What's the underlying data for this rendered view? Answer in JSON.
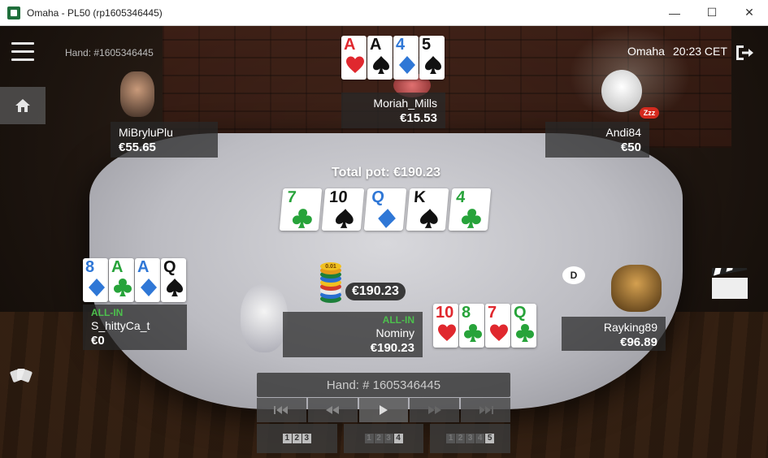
{
  "window": {
    "title": "Omaha - PL50 (rp1605346445)",
    "minimize": "—",
    "maximize": "☐",
    "close": "✕"
  },
  "hud": {
    "hand_label": "Hand: #1605346445",
    "game": "Omaha",
    "time": "20:23 CET"
  },
  "pot": {
    "total": "Total pot: €190.23",
    "center": "€190.23"
  },
  "board": [
    {
      "rank": "7",
      "suit": "club"
    },
    {
      "rank": "10",
      "suit": "spade"
    },
    {
      "rank": "Q",
      "suit": "diamond"
    },
    {
      "rank": "K",
      "suit": "spade"
    },
    {
      "rank": "4",
      "suit": "club"
    }
  ],
  "players": {
    "moriah": {
      "name": "Moriah_Mills",
      "stack": "€15.53",
      "cards": [
        {
          "rank": "A",
          "suit": "heart"
        },
        {
          "rank": "A",
          "suit": "spade"
        },
        {
          "rank": "4",
          "suit": "diamond"
        },
        {
          "rank": "5",
          "suit": "spade"
        }
      ]
    },
    "mibryluplu": {
      "name": "MiBryluPlu",
      "stack": "€55.65"
    },
    "andi": {
      "name": "Andi84",
      "stack": "€50",
      "sleep_badge": "Zzz"
    },
    "shitty": {
      "name": "S_hittyCa_t",
      "stack": "€0",
      "status": "ALL-IN",
      "cards": [
        {
          "rank": "8",
          "suit": "diamond"
        },
        {
          "rank": "A",
          "suit": "club"
        },
        {
          "rank": "A",
          "suit": "diamond"
        },
        {
          "rank": "Q",
          "suit": "spade"
        }
      ]
    },
    "nominy": {
      "name": "Nominy",
      "stack": "€190.23",
      "status": "ALL-IN",
      "cards": [
        {
          "rank": "10",
          "suit": "heart"
        },
        {
          "rank": "8",
          "suit": "club"
        },
        {
          "rank": "7",
          "suit": "heart"
        },
        {
          "rank": "Q",
          "suit": "club"
        }
      ]
    },
    "rayking": {
      "name": "Rayking89",
      "stack": "€96.89",
      "dealer": "D"
    }
  },
  "chips_label": "0.01",
  "replay": {
    "title": "Hand: # 1605346445",
    "streets": [
      [
        "1",
        "2",
        "3"
      ],
      [
        "1",
        "2",
        "3",
        "4"
      ],
      [
        "1",
        "2",
        "3",
        "4",
        "5"
      ]
    ]
  },
  "colors": {
    "spade": "#111111",
    "club": "#27a33a",
    "heart": "#e0282e",
    "diamond": "#2f77d6",
    "allin": "#4dc04d"
  }
}
